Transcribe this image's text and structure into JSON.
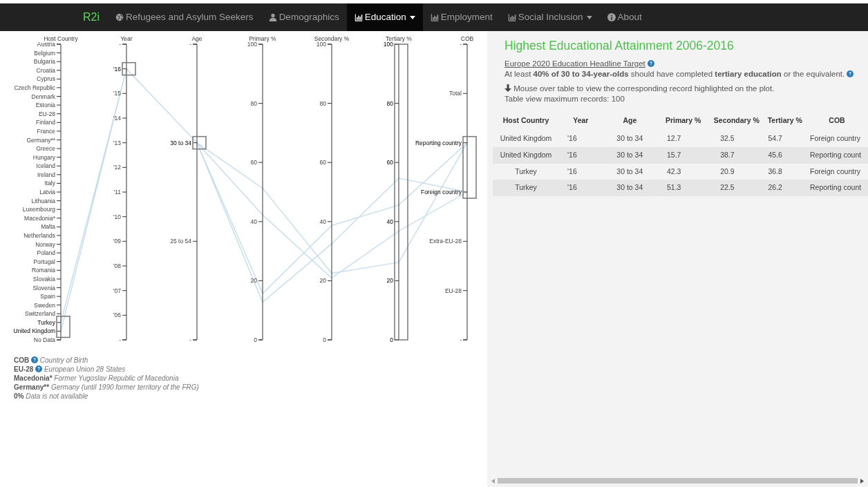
{
  "navbar": {
    "brand": "R2i",
    "items": [
      {
        "label": "Refugees and Asylum Seekers",
        "selected": false,
        "dropdown": false
      },
      {
        "label": "Demographics",
        "selected": false,
        "dropdown": false
      },
      {
        "label": "Education",
        "selected": true,
        "dropdown": true
      },
      {
        "label": "Employment",
        "selected": false,
        "dropdown": false
      },
      {
        "label": "Social Inclusion",
        "selected": false,
        "dropdown": true
      },
      {
        "label": "About",
        "selected": false,
        "dropdown": false
      }
    ]
  },
  "chart": {
    "axes": [
      {
        "title": "Host Country",
        "kind": "category",
        "ticks": [
          {
            "label": "Austria",
            "brushed": false
          },
          {
            "label": "Belgium",
            "brushed": false
          },
          {
            "label": "Bulgaria",
            "brushed": false
          },
          {
            "label": "Croatia",
            "brushed": false
          },
          {
            "label": "Cyprus",
            "brushed": false
          },
          {
            "label": "Czech Republic",
            "brushed": false
          },
          {
            "label": "Denmark",
            "brushed": false
          },
          {
            "label": "Estonia",
            "brushed": false
          },
          {
            "label": "EU-28",
            "brushed": false
          },
          {
            "label": "Finland",
            "brushed": false
          },
          {
            "label": "France",
            "brushed": false
          },
          {
            "label": "Germany**",
            "brushed": false
          },
          {
            "label": "Greece",
            "brushed": false
          },
          {
            "label": "Hungary",
            "brushed": false
          },
          {
            "label": "Iceland",
            "brushed": false
          },
          {
            "label": "Ireland",
            "brushed": false
          },
          {
            "label": "Italy",
            "brushed": false
          },
          {
            "label": "Latvia",
            "brushed": false
          },
          {
            "label": "Lithuania",
            "brushed": false
          },
          {
            "label": "Luxembourg",
            "brushed": false
          },
          {
            "label": "Macedonia*",
            "brushed": false
          },
          {
            "label": "Malta",
            "brushed": false
          },
          {
            "label": "Netherlands",
            "brushed": false
          },
          {
            "label": "Norway",
            "brushed": false
          },
          {
            "label": "Poland",
            "brushed": false
          },
          {
            "label": "Portugal",
            "brushed": false
          },
          {
            "label": "Romania",
            "brushed": false
          },
          {
            "label": "Slovakia",
            "brushed": false
          },
          {
            "label": "Slovenia",
            "brushed": false
          },
          {
            "label": "Spain",
            "brushed": false
          },
          {
            "label": "Sweden",
            "brushed": false
          },
          {
            "label": "Switzerland",
            "brushed": false
          },
          {
            "label": "Turkey",
            "brushed": true
          },
          {
            "label": "United Kingdom",
            "brushed": true
          },
          {
            "label": "No Data",
            "brushed": false
          }
        ]
      },
      {
        "title": "Year",
        "kind": "category",
        "ticks": [
          {
            "label": "-",
            "brushed": false
          },
          {
            "label": "'16",
            "brushed": true
          },
          {
            "label": "'15",
            "brushed": false
          },
          {
            "label": "'14",
            "brushed": false
          },
          {
            "label": "'13",
            "brushed": false
          },
          {
            "label": "'12",
            "brushed": false
          },
          {
            "label": "'11",
            "brushed": false
          },
          {
            "label": "'10",
            "brushed": false
          },
          {
            "label": "'09",
            "brushed": false
          },
          {
            "label": "'08",
            "brushed": false
          },
          {
            "label": "'07",
            "brushed": false
          },
          {
            "label": "'06",
            "brushed": false
          },
          {
            "label": "-",
            "brushed": false
          }
        ]
      },
      {
        "title": "Age",
        "kind": "category",
        "ticks": [
          {
            "label": "-",
            "brushed": false
          },
          {
            "label": "30 to 34",
            "brushed": true
          },
          {
            "label": "25 to 54",
            "brushed": false
          },
          {
            "label": "-",
            "brushed": false
          }
        ]
      },
      {
        "title": "Primary %",
        "kind": "numeric",
        "ticks": [
          {
            "label": "100",
            "brushed": false
          },
          {
            "label": "80",
            "brushed": false
          },
          {
            "label": "60",
            "brushed": false
          },
          {
            "label": "40",
            "brushed": false
          },
          {
            "label": "20",
            "brushed": false
          },
          {
            "label": "0",
            "brushed": false
          }
        ]
      },
      {
        "title": "Secondary %",
        "kind": "numeric",
        "ticks": [
          {
            "label": "100",
            "brushed": false
          },
          {
            "label": "80",
            "brushed": false
          },
          {
            "label": "60",
            "brushed": false
          },
          {
            "label": "40",
            "brushed": false
          },
          {
            "label": "20",
            "brushed": false
          },
          {
            "label": "0",
            "brushed": false
          }
        ]
      },
      {
        "title": "Tertiary %",
        "kind": "numeric",
        "ticks": [
          {
            "label": "100",
            "brushed": true
          },
          {
            "label": "80",
            "brushed": true
          },
          {
            "label": "60",
            "brushed": true
          },
          {
            "label": "40",
            "brushed": true
          },
          {
            "label": "20",
            "brushed": true
          },
          {
            "label": "0",
            "brushed": true
          }
        ]
      },
      {
        "title": "COB",
        "kind": "category",
        "ticks": [
          {
            "label": "-",
            "brushed": false
          },
          {
            "label": "Total",
            "brushed": false
          },
          {
            "label": "Reporting country",
            "brushed": true
          },
          {
            "label": "Foreign country",
            "brushed": true
          },
          {
            "label": "Extra-EU-28",
            "brushed": false
          },
          {
            "label": "EU-28",
            "brushed": false
          },
          {
            "label": "-",
            "brushed": false
          }
        ]
      }
    ]
  },
  "legend": [
    {
      "term": "COB",
      "help": true,
      "description": "Country of Birth"
    },
    {
      "term": "EU-28",
      "help": true,
      "description": "European Union 28 States"
    },
    {
      "term": "Macedonia*",
      "help": false,
      "description": "Former Yugoslav Republic of Macedonia"
    },
    {
      "term": "Germany**",
      "help": false,
      "description": "Germany (until 1990 former territory of the FRG)"
    },
    {
      "term": "0%",
      "help": false,
      "description": "Data is not available"
    }
  ],
  "panel": {
    "title": "Highest Educational Attainment 2006-2016",
    "target_link": "Europe 2020 Education Headline Target",
    "target_text": "At least **40% of 30 to 34-year-olds** should have completed **tertiary education** or the equivalent.",
    "hint": "Mouse over table to view the corresponding record highlighted on the plot.",
    "max_records": "Table view maximum records: 100"
  },
  "table": {
    "columns": [
      "Host Country",
      "Year",
      "Age",
      "Primary %",
      "Secondary %",
      "Tertiary %",
      "COB"
    ],
    "rows": [
      {
        "cells": [
          "United Kingdom",
          "'16",
          "30 to 34",
          "12.7",
          "32.5",
          "54.7",
          "Foreign country"
        ]
      },
      {
        "cells": [
          "United Kingdom",
          "'16",
          "30 to 34",
          "15.7",
          "38.7",
          "45.6",
          "Reporting count"
        ]
      },
      {
        "cells": [
          "Turkey",
          "'16",
          "30 to 34",
          "42.3",
          "20.9",
          "36.8",
          "Foreign country"
        ]
      },
      {
        "cells": [
          "Turkey",
          "'16",
          "30 to 34",
          "51.3",
          "22.5",
          "26.2",
          "Reporting count"
        ]
      }
    ]
  }
}
